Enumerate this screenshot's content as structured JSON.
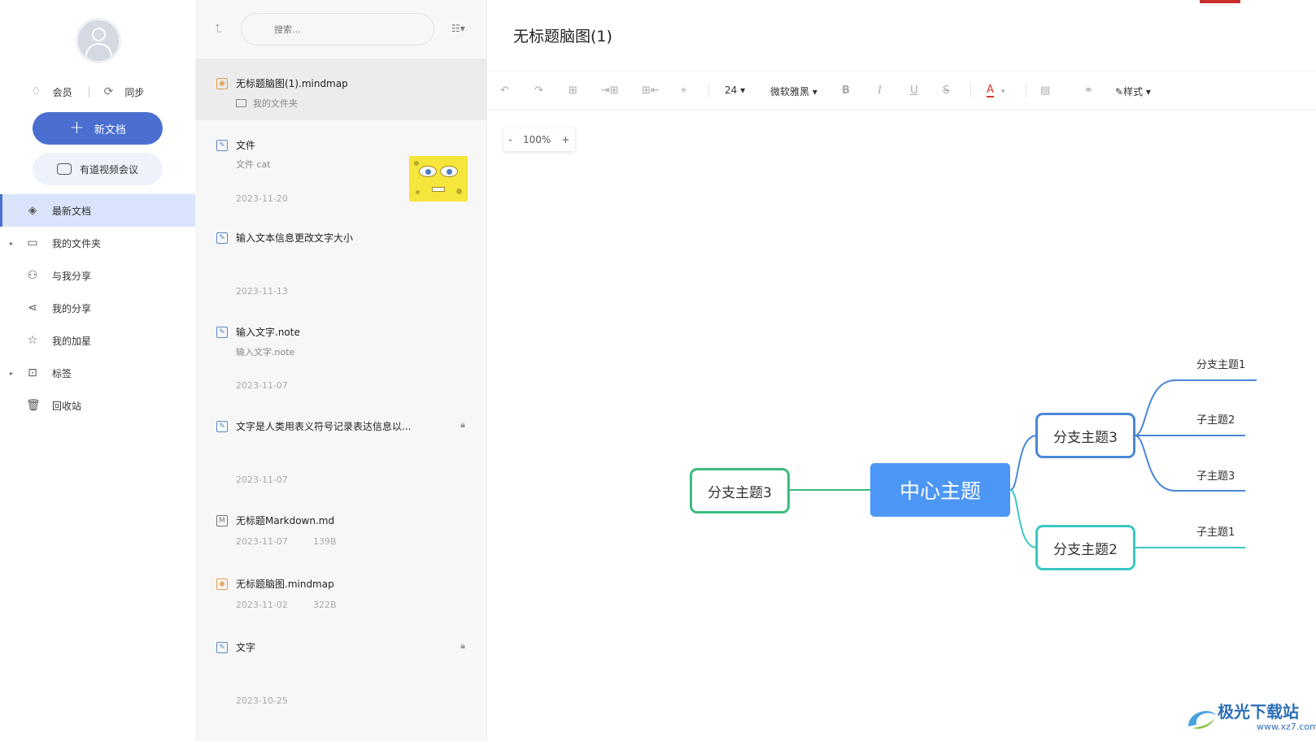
{
  "sidebar": {
    "member_label": "会员",
    "sync_label": "同步",
    "new_doc_label": "新文档",
    "meeting_label": "有道视频会议",
    "nav": [
      {
        "label": "最新文档",
        "icon": "layers-icon",
        "glyph": "◈",
        "active": true,
        "arrow": false
      },
      {
        "label": "我的文件夹",
        "icon": "folder-icon",
        "glyph": "▭",
        "active": false,
        "arrow": true
      },
      {
        "label": "与我分享",
        "icon": "users-icon",
        "glyph": "⚇",
        "active": false,
        "arrow": false
      },
      {
        "label": "我的分享",
        "icon": "share-icon",
        "glyph": "⋖",
        "active": false,
        "arrow": false
      },
      {
        "label": "我的加星",
        "icon": "star-icon",
        "glyph": "☆",
        "active": false,
        "arrow": false
      },
      {
        "label": "标签",
        "icon": "tag-icon",
        "glyph": "⊡",
        "active": false,
        "arrow": true
      },
      {
        "label": "回收站",
        "icon": "trash-icon",
        "glyph": "🗑",
        "active": false,
        "arrow": false
      }
    ]
  },
  "filelist": {
    "search_placeholder": "搜索...",
    "items": [
      {
        "title": "无标题脑图(1).mindmap",
        "sub": "我的文件夹",
        "date": "",
        "size": "",
        "type": "mindmap",
        "selected": true,
        "lock": false
      },
      {
        "title": "文件",
        "sub": "文件 cat",
        "date": "2023-11-20",
        "size": "",
        "type": "note",
        "selected": false,
        "lock": false,
        "thumb": true
      },
      {
        "title": "输入文本信息更改文字大小",
        "sub": "",
        "date": "2023-11-13",
        "size": "",
        "type": "note",
        "selected": false,
        "lock": false
      },
      {
        "title": "输入文字.note",
        "sub": "输入文字.note",
        "date": "2023-11-07",
        "size": "",
        "type": "note",
        "selected": false,
        "lock": false
      },
      {
        "title": "文字是人类用表义符号记录表达信息以...",
        "sub": "",
        "date": "2023-11-07",
        "size": "",
        "type": "note",
        "selected": false,
        "lock": true
      },
      {
        "title": "无标题Markdown.md",
        "sub": "",
        "date": "2023-11-07",
        "size": "139B",
        "type": "md",
        "selected": false,
        "lock": false
      },
      {
        "title": "无标题脑图.mindmap",
        "sub": "",
        "date": "2023-11-02",
        "size": "322B",
        "type": "mindmap",
        "selected": false,
        "lock": false
      },
      {
        "title": "文字",
        "sub": "",
        "date": "2023-10-25",
        "size": "",
        "type": "note",
        "selected": false,
        "lock": true
      }
    ]
  },
  "editor": {
    "title": "无标题脑图(1)",
    "toolbar": {
      "font_size": "24",
      "font_family": "微软雅黑",
      "bold": "B",
      "italic": "I",
      "underline": "U",
      "font_color": "A",
      "style_label": "样式"
    },
    "zoom": {
      "minus": "-",
      "value": "100%",
      "plus": "+"
    },
    "mindmap": {
      "center": "中心主题",
      "left_branch": "分支主题3",
      "right_top_branch": "分支主题3",
      "right_bottom_branch": "分支主题2",
      "top_subs": [
        "分支主题1",
        "子主题2",
        "子主题3"
      ],
      "bottom_subs": [
        "子主题1"
      ],
      "colors": {
        "center": "#4c97f5",
        "left": "#3cbd7e",
        "right_top": "#4a86d6",
        "right_bottom": "#3ac7c4"
      }
    }
  },
  "watermark": {
    "text": "极光下载站",
    "url": "www.xz7.com"
  }
}
